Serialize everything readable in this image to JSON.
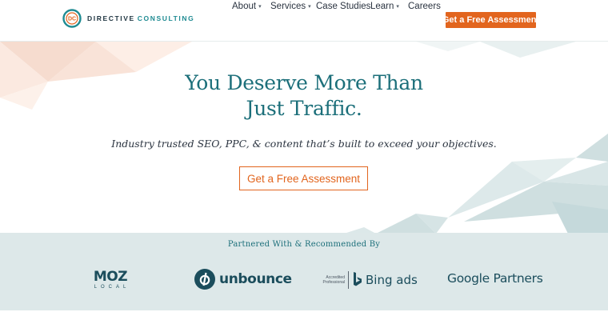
{
  "brand": {
    "logo_initials": "DC",
    "name_part1": "DIRECTIVE",
    "name_part2": "CONSULTING",
    "primary_color": "#1c6f7a",
    "accent_color": "#e2651e"
  },
  "nav": {
    "items": [
      {
        "label": "About",
        "has_dropdown": true
      },
      {
        "label": "Services",
        "has_dropdown": true
      },
      {
        "label": "Case Studies",
        "has_dropdown": false
      },
      {
        "label": "Learn",
        "has_dropdown": true
      },
      {
        "label": "Careers",
        "has_dropdown": false
      }
    ],
    "dropdown_glyph": "▾",
    "cta_label": "Get a Free Assessment"
  },
  "hero": {
    "title_line1": "You Deserve More Than",
    "title_line2": "Just Traffic.",
    "subtitle": "Industry trusted SEO, PPC, & content that’s built to exceed your objectives.",
    "cta_label": "Get a Free Assessment"
  },
  "partners": {
    "title": "Partnered With & Recommended By",
    "moz": {
      "word": "MOZ",
      "sub": "LOCAL"
    },
    "unbounce": {
      "word": "unbounce",
      "icon": "unbounce-icon"
    },
    "bing": {
      "badge_line1": "Accredited",
      "badge_line2": "Professional",
      "word": "Bing ads"
    },
    "google": {
      "word": "Google Partners"
    }
  }
}
